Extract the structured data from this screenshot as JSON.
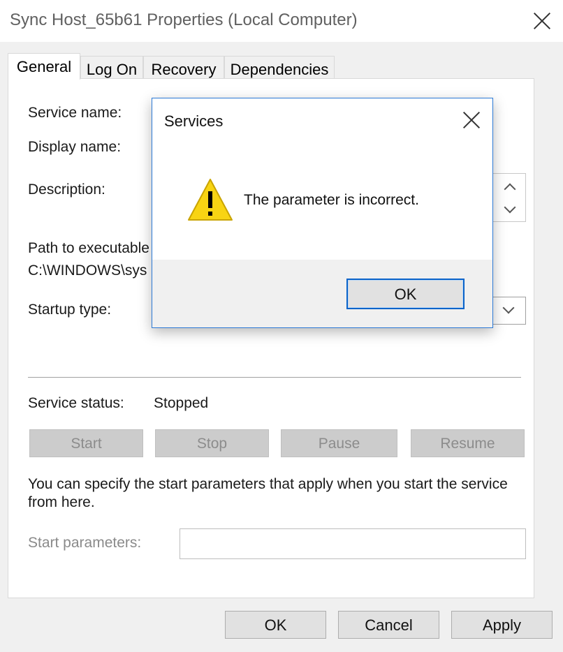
{
  "window": {
    "title": "Sync Host_65b61 Properties (Local Computer)"
  },
  "tabs": [
    {
      "label": "General",
      "active": true
    },
    {
      "label": "Log On"
    },
    {
      "label": "Recovery"
    },
    {
      "label": "Dependencies"
    }
  ],
  "general": {
    "service_name_label": "Service name:",
    "display_name_label": "Display name:",
    "description_label": "Description:",
    "path_label": "Path to executable",
    "path_value": "C:\\WINDOWS\\sys",
    "startup_type_label": "Startup type:",
    "service_status_label": "Service status:",
    "service_status_value": "Stopped",
    "buttons": {
      "start": "Start",
      "stop": "Stop",
      "pause": "Pause",
      "resume": "Resume"
    },
    "hint_line1": "You can specify the start parameters that apply when you start the service",
    "hint_line2": "from here.",
    "start_params_label": "Start parameters:",
    "start_params_value": ""
  },
  "footer": {
    "ok": "OK",
    "cancel": "Cancel",
    "apply": "Apply"
  },
  "dialog": {
    "title": "Services",
    "message": "The parameter is incorrect.",
    "ok": "OK",
    "icon": "warning-icon"
  },
  "colors": {
    "accent": "#0a63c9",
    "warning_fill": "#f8d413",
    "disabled_button": "#cccccc"
  }
}
